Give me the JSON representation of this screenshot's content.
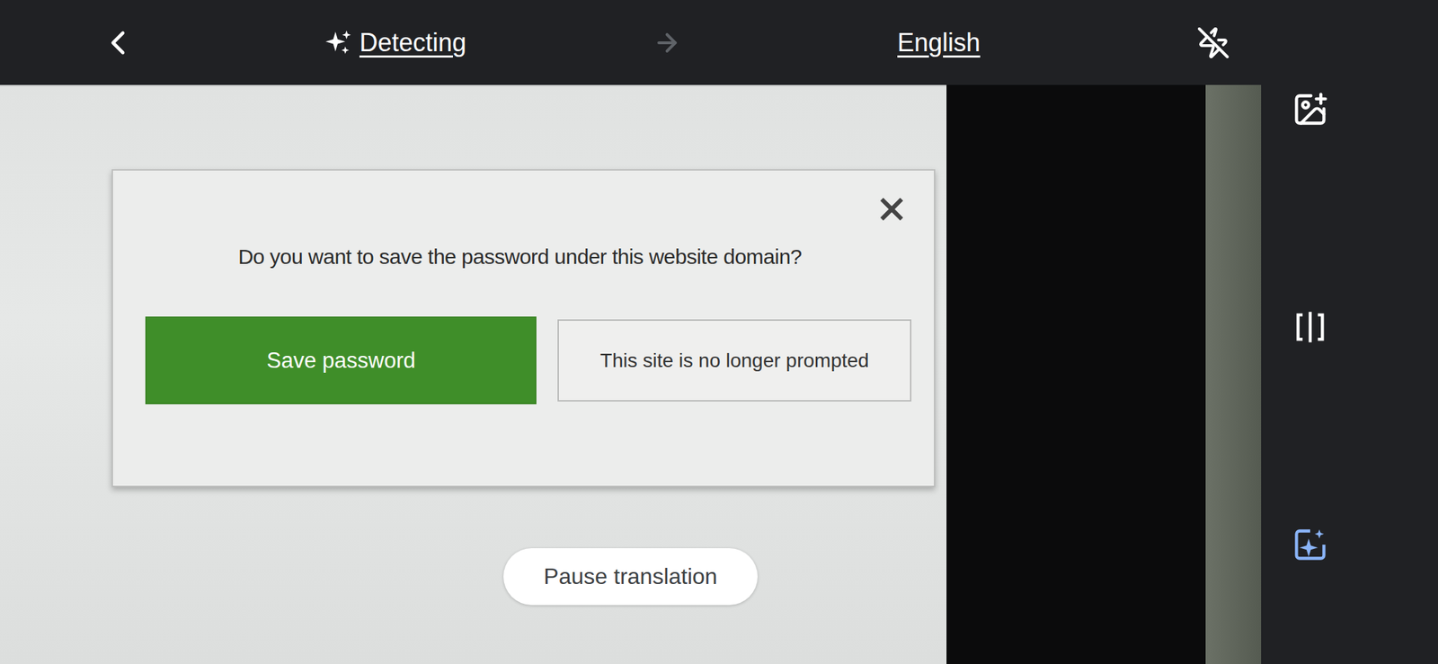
{
  "top_bar": {
    "source_language": "Detecting",
    "target_language": "English",
    "flash": {
      "on": false
    }
  },
  "dialog": {
    "title": "Do you want to save the password under this website domain?",
    "buttons": [
      {
        "label": "Save password",
        "primary": true
      },
      {
        "label": "This site is no longer prompted",
        "primary": false
      }
    ]
  },
  "pause_button": {
    "label": "Pause translation"
  }
}
